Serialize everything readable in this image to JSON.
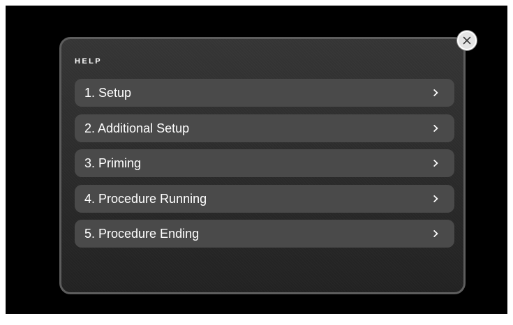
{
  "help_dialog": {
    "title": "HELP",
    "items": [
      {
        "label": "1. Setup",
        "icon": "chevron-right-icon"
      },
      {
        "label": "2. Additional Setup",
        "icon": "chevron-right-icon"
      },
      {
        "label": "3. Priming",
        "icon": "chevron-right-icon"
      },
      {
        "label": "4. Procedure Running",
        "icon": "chevron-right-icon"
      },
      {
        "label": "5. Procedure Ending",
        "icon": "chevron-right-icon"
      }
    ],
    "close_icon": "close-icon"
  },
  "colors": {
    "screen_background": "#000000",
    "dialog_background": "#2e2e2e",
    "dialog_border": "#5d5d5d",
    "menu_item_background": "#4a4a4a",
    "text": "#ffffff",
    "close_button_background": "#e4e4e4"
  }
}
